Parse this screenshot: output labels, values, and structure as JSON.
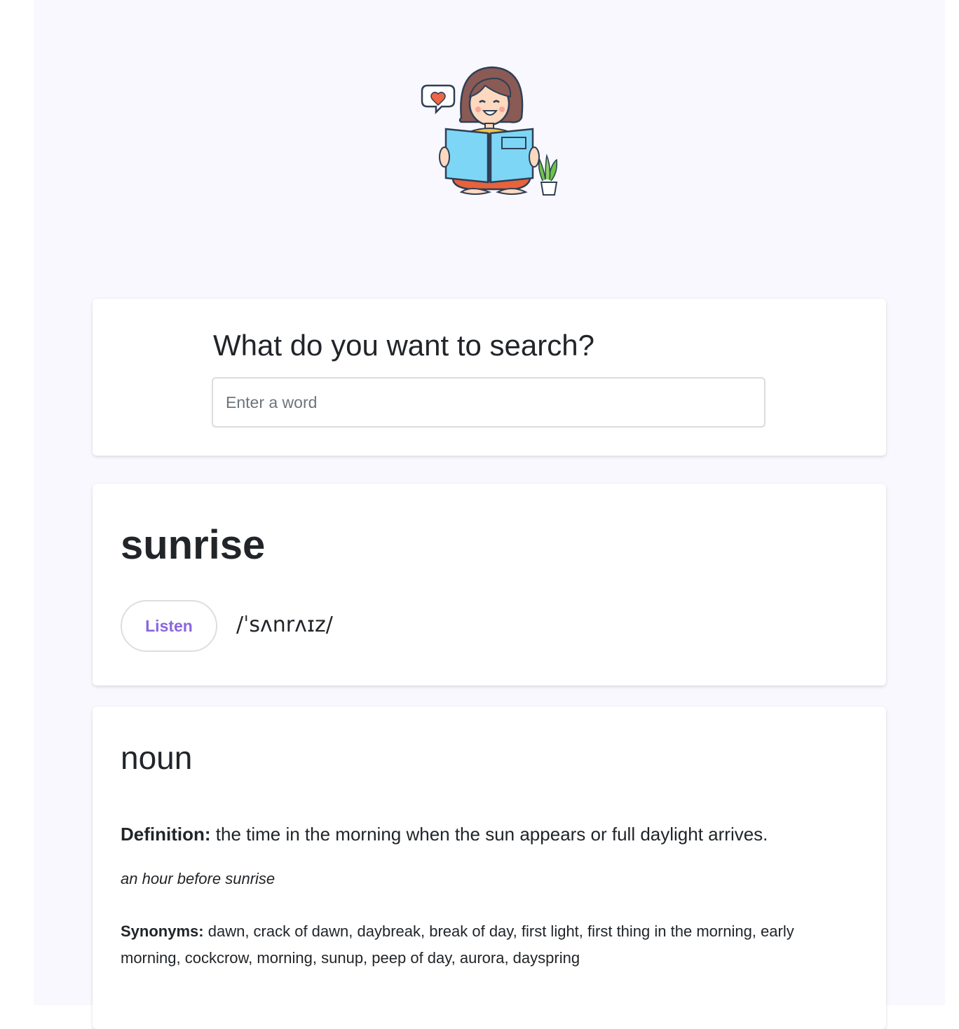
{
  "search": {
    "title": "What do you want to search?",
    "placeholder": "Enter a word",
    "value": ""
  },
  "result": {
    "word": "sunrise",
    "listen_label": "Listen",
    "phonetic": "/ˈsʌnrʌɪz/"
  },
  "meaning": {
    "part_of_speech": "noun",
    "definition_label": "Definition:",
    "definition": "the time in the morning when the sun appears or full daylight arrives.",
    "example": "an hour before sunrise",
    "synonyms_label": "Synonyms:",
    "synonyms": "dawn, crack of dawn, daybreak, break of day, first light, first thing in the morning, early morning, cockcrow, morning, sunup, peep of day, aurora, dayspring"
  },
  "colors": {
    "page_background": "#f8f8fe",
    "accent": "#8b65e0",
    "text": "#212529"
  }
}
